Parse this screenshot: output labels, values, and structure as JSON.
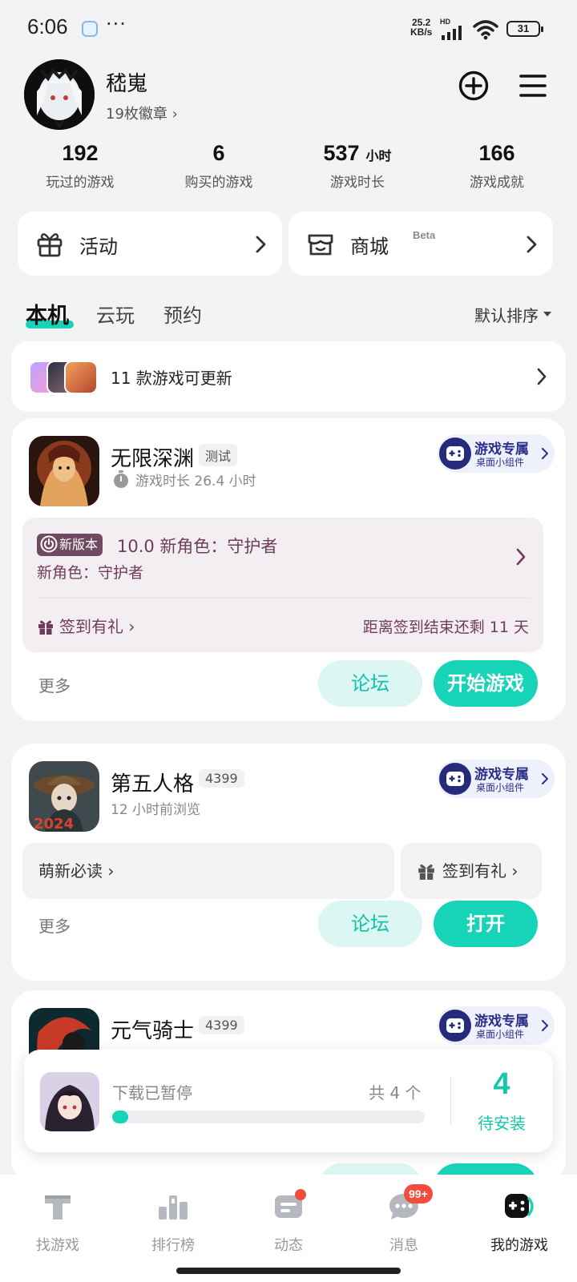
{
  "status_bar": {
    "time": "6:06",
    "dots": "···",
    "net_speed_value": "25.2",
    "net_speed_unit": "KB/s",
    "hd": "HD",
    "battery": "31"
  },
  "profile": {
    "username": "嵇嵬",
    "badges_text": "19枚徽章 ›"
  },
  "stats": [
    {
      "value": "192",
      "unit": "",
      "label": "玩过的游戏"
    },
    {
      "value": "6",
      "unit": "",
      "label": "购买的游戏"
    },
    {
      "value": "537",
      "unit": "小时",
      "label": "游戏时长"
    },
    {
      "value": "166",
      "unit": "",
      "label": "游戏成就"
    }
  ],
  "quick_links": {
    "activity": "活动",
    "mall": "商城",
    "mall_beta": "Beta"
  },
  "tabs": {
    "local": "本机",
    "cloud": "云玩",
    "reserve": "预约",
    "sort": "默认排序"
  },
  "update_banner": {
    "text": "11 款游戏可更新"
  },
  "games": [
    {
      "title": "无限深渊",
      "tag": "测试",
      "subtitle": "游戏时长 26.4 小时",
      "widget_title": "游戏专属",
      "widget_sub": "桌面小组件",
      "news_badge": "新版本",
      "news_title": "10.0 新角色：守护者",
      "news_desc": "新角色：守护者",
      "sign_in": "签到有礼 ›",
      "remaining": "距离签到结束还剩 11 天",
      "more": "更多",
      "forum": "论坛",
      "action": "开始游戏"
    },
    {
      "title": "第五人格",
      "tag": "4399",
      "subtitle": "12 小时前浏览",
      "widget_title": "游戏专属",
      "widget_sub": "桌面小组件",
      "guide": "萌新必读 ›",
      "sign_in": "签到有礼 ›",
      "more": "更多",
      "forum": "论坛",
      "action": "打开"
    },
    {
      "title": "元气骑士",
      "tag": "4399",
      "widget_title": "游戏专属",
      "widget_sub": "桌面小组件"
    }
  ],
  "download": {
    "status": "下载已暂停",
    "total": "共 4 个",
    "count": "4",
    "count_label": "待安装",
    "progress": 0.05
  },
  "bottom_nav": [
    {
      "label": "找游戏",
      "icon": "find-games-icon"
    },
    {
      "label": "排行榜",
      "icon": "ranking-icon"
    },
    {
      "label": "动态",
      "icon": "feed-icon"
    },
    {
      "label": "消息",
      "icon": "message-icon",
      "badge": "99+"
    },
    {
      "label": "我的游戏",
      "icon": "gamepad-icon"
    }
  ],
  "colors": {
    "accent": "#17d3b7",
    "news_text": "#6f3c5a",
    "widget_text": "#2b2f8a",
    "badge_red": "#f24c3d"
  }
}
